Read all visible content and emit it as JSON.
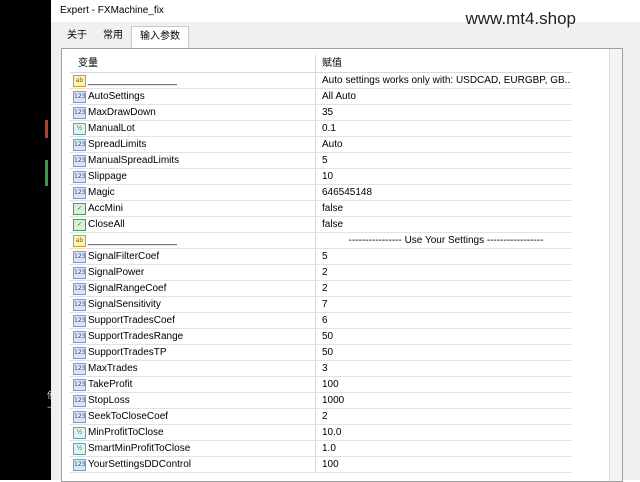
{
  "window": {
    "title": "Expert - FXMachine_fix"
  },
  "watermark": "www.mt4.shop",
  "left_strip": {
    "labels": [
      "使",
      "下"
    ]
  },
  "tabs": [
    {
      "label": "关于",
      "active": false
    },
    {
      "label": "常用",
      "active": false
    },
    {
      "label": "输入参数",
      "active": true
    }
  ],
  "table": {
    "headers": {
      "variable": "变量",
      "value": "赋值"
    },
    "rows": [
      {
        "type": "str",
        "icon": "ab",
        "name": "________________",
        "value": "Auto settings works only with: USDCAD, EURGBP, GB..."
      },
      {
        "type": "int",
        "icon": "123",
        "name": "AutoSettings",
        "value": "All Auto"
      },
      {
        "type": "int",
        "icon": "123",
        "name": "MaxDrawDown",
        "value": "35"
      },
      {
        "type": "dbl",
        "icon": "½",
        "name": "ManualLot",
        "value": "0.1"
      },
      {
        "type": "int",
        "icon": "123",
        "name": "SpreadLimits",
        "value": "Auto"
      },
      {
        "type": "int",
        "icon": "123",
        "name": "ManualSpreadLimits",
        "value": "5"
      },
      {
        "type": "int",
        "icon": "123",
        "name": "Slippage",
        "value": "10"
      },
      {
        "type": "int",
        "icon": "123",
        "name": "Magic",
        "value": "646545148"
      },
      {
        "type": "bool",
        "icon": "✓",
        "name": "AccMini",
        "value": "false"
      },
      {
        "type": "bool",
        "icon": "✓",
        "name": "CloseAll",
        "value": "false"
      },
      {
        "type": "str",
        "icon": "ab",
        "name": "________________",
        "value": "---------------- Use Your Settings -----------------"
      },
      {
        "type": "int",
        "icon": "123",
        "name": "SignalFilterCoef",
        "value": "5"
      },
      {
        "type": "int",
        "icon": "123",
        "name": "SignalPower",
        "value": "2"
      },
      {
        "type": "int",
        "icon": "123",
        "name": "SignalRangeCoef",
        "value": "2"
      },
      {
        "type": "int",
        "icon": "123",
        "name": "SignalSensitivity",
        "value": "7"
      },
      {
        "type": "int",
        "icon": "123",
        "name": "SupportTradesCoef",
        "value": "6"
      },
      {
        "type": "int",
        "icon": "123",
        "name": "SupportTradesRange",
        "value": "50"
      },
      {
        "type": "int",
        "icon": "123",
        "name": "SupportTradesTP",
        "value": "50"
      },
      {
        "type": "int",
        "icon": "123",
        "name": "MaxTrades",
        "value": "3"
      },
      {
        "type": "int",
        "icon": "123",
        "name": "TakeProfit",
        "value": "100"
      },
      {
        "type": "int",
        "icon": "123",
        "name": "StopLoss",
        "value": "1000"
      },
      {
        "type": "int",
        "icon": "123",
        "name": "SeekToCloseCoef",
        "value": "2"
      },
      {
        "type": "dbl",
        "icon": "½",
        "name": "MinProfitToClose",
        "value": "10.0"
      },
      {
        "type": "dbl",
        "icon": "½",
        "name": "SmartMinProfitToClose",
        "value": "1.0"
      },
      {
        "type": "int",
        "icon": "123",
        "name": "YourSettingsDDControl",
        "value": "100"
      }
    ]
  }
}
